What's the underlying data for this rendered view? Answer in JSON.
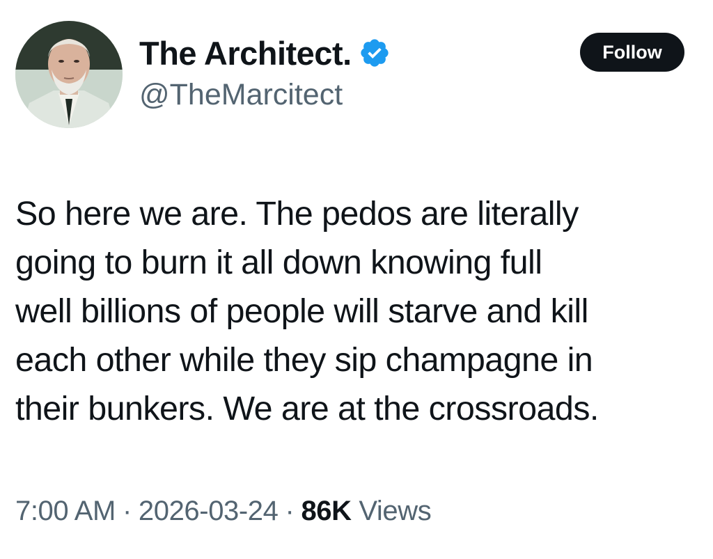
{
  "author": {
    "display_name": "The Architect.",
    "handle": "@TheMarcitect",
    "verified": true,
    "avatar_icon": "avatar-photo-icon"
  },
  "follow_label": "Follow",
  "body_lines": [
    "So here we are. The pedos are literally",
    "going to burn it all down knowing full",
    "well billions of people will starve and kill",
    "each other while they sip champagne in",
    "their bunkers. We are at the crossroads."
  ],
  "meta": {
    "time": "7:00 AM",
    "separator": "·",
    "date": "2026-03-24",
    "views_count": "86K",
    "views_label": "Views"
  },
  "colors": {
    "text": "#0f1419",
    "secondary": "#536471",
    "verified_blue": "#1d9bf0",
    "button_bg": "#0f1419"
  }
}
